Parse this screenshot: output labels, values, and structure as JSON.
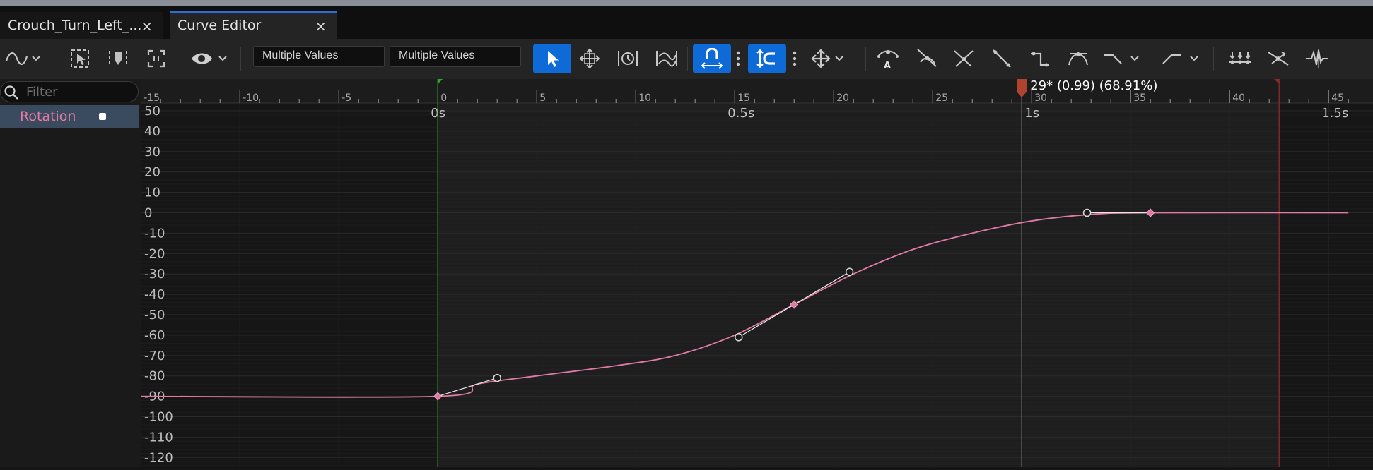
{
  "tabs": [
    {
      "label": "Crouch_Turn_Left_..."
    },
    {
      "label": "Curve Editor"
    }
  ],
  "tab_close_glyph": "×",
  "toolbar": {
    "field1_value": "Multiple Values",
    "field2_value": "Multiple Values",
    "icons": [
      "curve-view-icon",
      "select-keys-icon",
      "retime-icon",
      "transform-box-icon",
      "visibility-icon",
      "select-arrow-icon",
      "frame-all-icon",
      "frame-time-icon",
      "normalize-icon",
      "snap-time-icon",
      "snap-value-icon",
      "transform-move-icon",
      "tangent-auto-icon",
      "tangent-user-icon",
      "tangent-break-icon",
      "tangent-linear-icon",
      "tangent-constant-icon",
      "tangent-weighted-icon",
      "pre-infinity-icon",
      "post-infinity-icon",
      "flatten-icon",
      "straighten-icon",
      "filter-icon"
    ]
  },
  "sidebar": {
    "filter_placeholder": "Filter",
    "items": [
      {
        "label": "Rotation"
      }
    ]
  },
  "colors": {
    "accent": "#0d6ad6",
    "curve": "#e27aa6",
    "start_line": "#2fa52f",
    "end_line": "#8d2a2a"
  },
  "playhead_label": "29* (0.99) (68.91%)",
  "frame_ruler": {
    "min_frame": -15,
    "max_frame": 46,
    "labeled_frames": [
      "-15",
      "-10",
      "-5",
      "0",
      "5",
      "10",
      "15",
      "20",
      "25",
      "30",
      "35",
      "40",
      "45"
    ]
  },
  "time_labels": [
    "0s",
    "0.5s",
    "1s",
    "1.5s"
  ],
  "y_axis": {
    "labels": [
      "50",
      "40",
      "30",
      "20",
      "10",
      "0",
      "-10",
      "-20",
      "-30",
      "-40",
      "-50",
      "-60",
      "-70",
      "-80",
      "-90",
      "-100",
      "-110",
      "-120"
    ],
    "range": [
      -120,
      50
    ]
  },
  "curve": {
    "name": "Rotation",
    "keys": [
      {
        "frame": 0,
        "value": -90
      },
      {
        "frame": 18,
        "value": -45
      },
      {
        "frame": 36,
        "value": 0
      }
    ],
    "tangent_handles": [
      {
        "frame": 3,
        "value": -81
      },
      {
        "frame": 15.2,
        "value": -61
      },
      {
        "frame": 20.8,
        "value": -29
      },
      {
        "frame": 32.8,
        "value": 0
      }
    ],
    "sample_points": [
      {
        "frame": -15,
        "value": -90
      },
      {
        "frame": 0,
        "value": -90
      },
      {
        "frame": 2,
        "value": -84
      },
      {
        "frame": 5,
        "value": -80
      },
      {
        "frame": 9,
        "value": -75
      },
      {
        "frame": 12,
        "value": -70
      },
      {
        "frame": 15,
        "value": -60
      },
      {
        "frame": 18,
        "value": -45
      },
      {
        "frame": 21,
        "value": -30
      },
      {
        "frame": 24,
        "value": -18
      },
      {
        "frame": 27,
        "value": -10
      },
      {
        "frame": 30,
        "value": -4
      },
      {
        "frame": 33,
        "value": -0.8
      },
      {
        "frame": 36,
        "value": 0
      },
      {
        "frame": 46,
        "value": 0
      }
    ]
  },
  "playhead_frame": 29.5,
  "start_frame": 0,
  "end_frame": 42.5
}
